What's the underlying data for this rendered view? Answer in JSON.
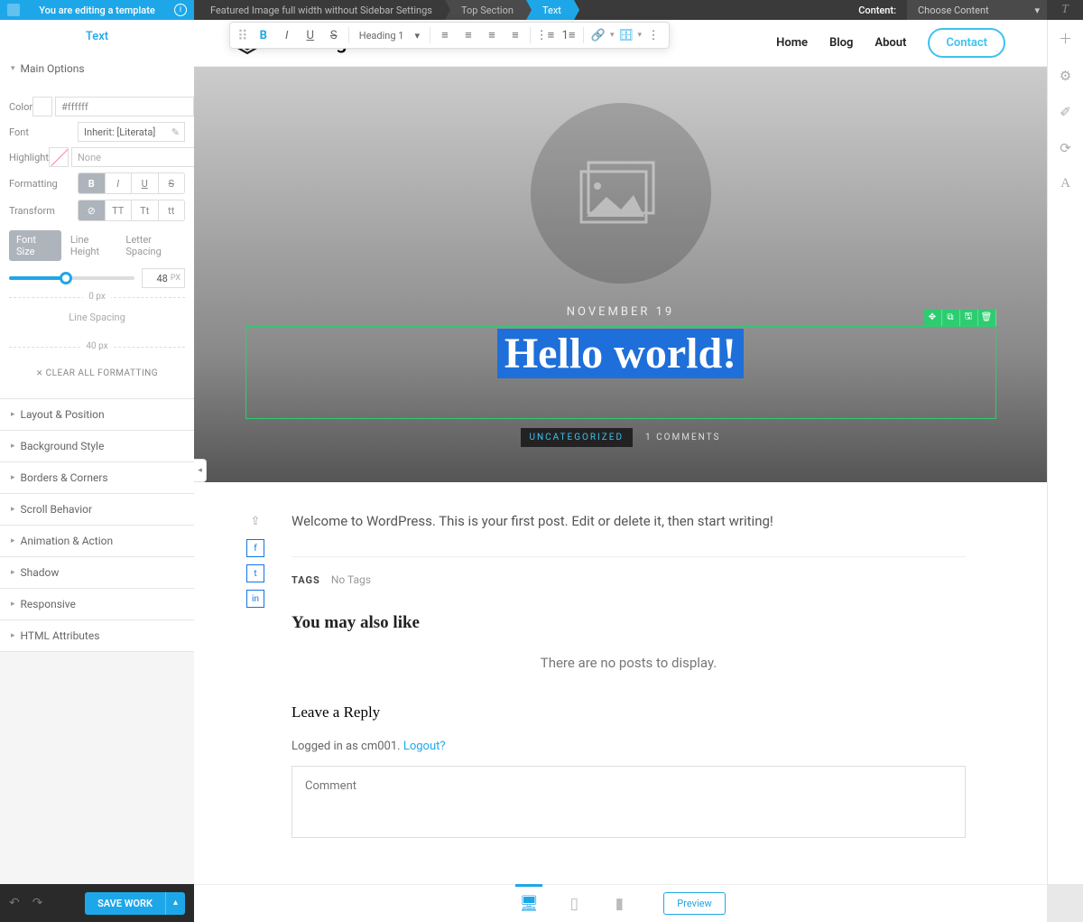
{
  "topbar": {
    "editing_text": "You are editing a template",
    "breadcrumbs": [
      "Featured Image full width without Sidebar Settings",
      "Top Section",
      "Text"
    ],
    "content_label": "Content:",
    "content_select": "Choose Content"
  },
  "sidebar": {
    "title": "Text",
    "main_options_label": "Main Options",
    "rows": {
      "color_label": "Color",
      "color_value": "#ffffff",
      "font_label": "Font",
      "font_value": "Inherit: [Literata]",
      "highlight_label": "Highlight",
      "highlight_value": "None",
      "formatting_label": "Formatting",
      "transform_label": "Transform"
    },
    "size_tabs": [
      "Font Size",
      "Line Height",
      "Letter Spacing"
    ],
    "font_size_value": "48",
    "font_size_unit": "PX",
    "sep1": "0 px",
    "line_spacing_label": "Line Spacing",
    "sep2": "40 px",
    "clear_formatting": "CLEAR ALL FORMATTING",
    "panels": [
      "Layout & Position",
      "Background Style",
      "Borders & Corners",
      "Scroll Behavior",
      "Animation & Action",
      "Shadow",
      "Responsive",
      "HTML Attributes"
    ]
  },
  "bottombar": {
    "save": "SAVE WORK"
  },
  "float_toolbar": {
    "heading": "Heading 1"
  },
  "page": {
    "logo_text": "Your Logo",
    "nav": [
      "Home",
      "Blog",
      "About"
    ],
    "contact": "Contact",
    "hero_date": "NOVEMBER 19",
    "hero_title": "Hello world!",
    "category": "UNCATEGORIZED",
    "comments": "1 COMMENTS",
    "post_text": "Welcome to WordPress. This is your first post. Edit or delete it, then start writing!",
    "tags_label": "TAGS",
    "tags_value": "No Tags",
    "also_like": "You may also like",
    "no_posts": "There are no posts to display.",
    "reply_heading": "Leave a Reply",
    "logged_prefix": "Logged in as cm001. ",
    "logout": "Logout?",
    "comment_placeholder": "Comment"
  },
  "footer": {
    "preview": "Preview"
  }
}
